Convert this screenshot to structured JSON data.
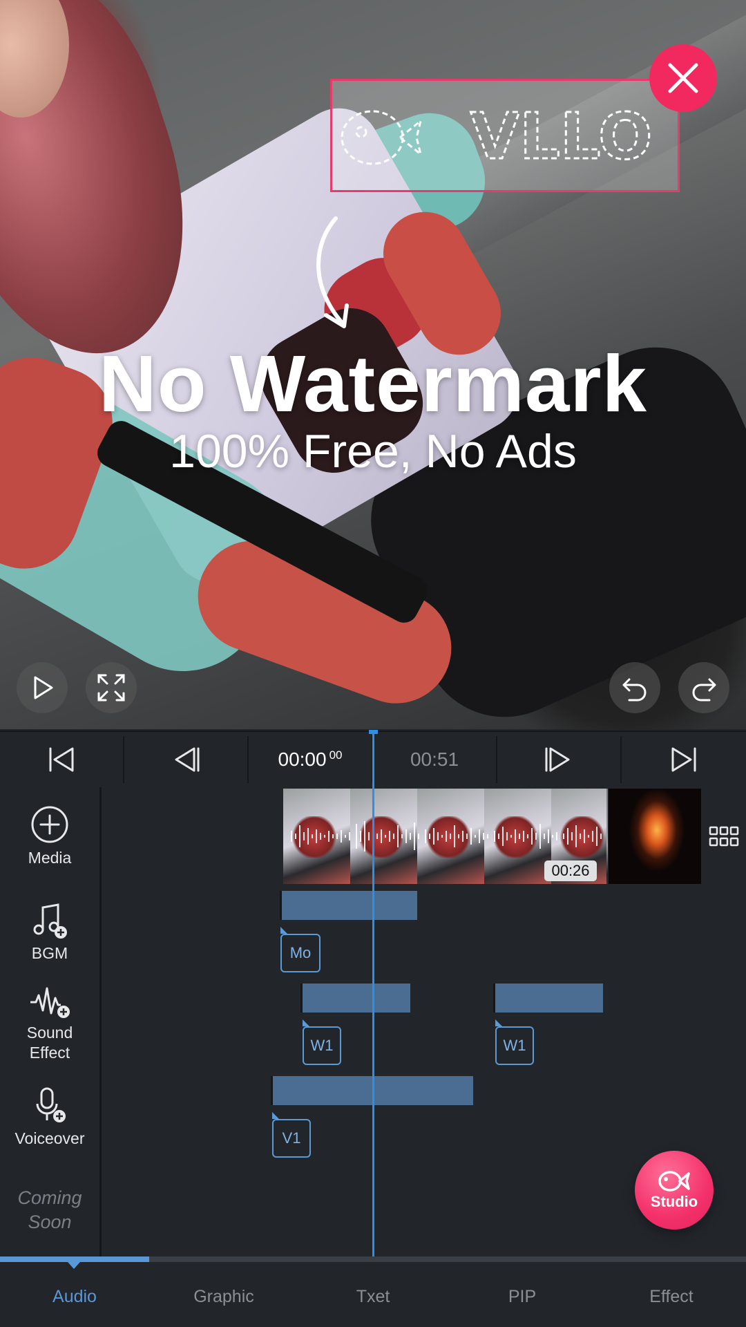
{
  "preview": {
    "watermark_text": "VLLO",
    "headline": "No Watermark",
    "subline": "100% Free, No Ads"
  },
  "transport": {
    "current_time": "00:00",
    "current_frames": "00",
    "total_time": "00:51"
  },
  "timeline": {
    "media_label": "Media",
    "clip_duration": "00:26",
    "bgm_label": "BGM",
    "bgm_tag": "Mo",
    "sound_effect_label_line1": "Sound",
    "sound_effect_label_line2": "Effect",
    "sound_effect_tags": [
      "W1",
      "W1"
    ],
    "voiceover_label": "Voiceover",
    "voiceover_tag": "V1",
    "coming_soon_line1": "Coming",
    "coming_soon_line2": "Soon"
  },
  "studio_button": {
    "label": "Studio",
    "color": "#f3306a"
  },
  "tabs": [
    {
      "label": "Audio",
      "active": true
    },
    {
      "label": "Graphic",
      "active": false
    },
    {
      "label": "Txet",
      "active": false
    },
    {
      "label": "PIP",
      "active": false
    },
    {
      "label": "Effect",
      "active": false
    }
  ],
  "colors": {
    "accent": "#5a97d6",
    "playhead": "#2f8ee6",
    "watermark_border": "#e83a6d"
  }
}
